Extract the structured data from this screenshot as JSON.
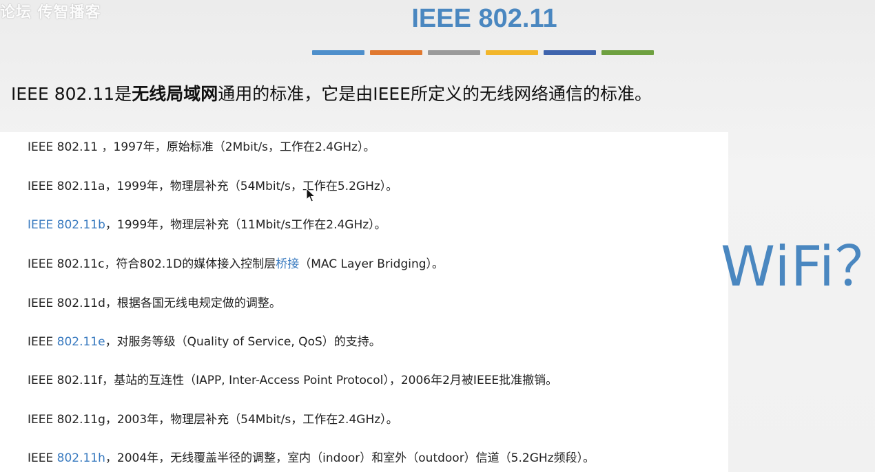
{
  "watermark": "论坛 传智播客",
  "title": "IEEE 802.11",
  "divider_colors": [
    "#4e8fcb",
    "#e0782f",
    "#9a9a9a",
    "#f2b62b",
    "#3f64ad",
    "#6ea040"
  ],
  "intro": {
    "prefix": "IEEE 802.11是",
    "bold": "无线局域网",
    "suffix": "通用的标准，它是由IEEE所定义的无线网络通信的标准。"
  },
  "items": [
    {
      "pre": "IEEE 802.11 ，1997年，原始标准（2Mbit/s，工作在2.4GHz）。",
      "link": "",
      "post": ""
    },
    {
      "pre": "IEEE 802.11a，1999年，物理层补充（54Mbit/s，工作在5.2GHz）。",
      "link": "",
      "post": ""
    },
    {
      "pre": "",
      "link": "IEEE 802.11b",
      "post": "，1999年，物理层补充（11Mbit/s工作在2.4GHz）。"
    },
    {
      "pre": "IEEE 802.11c，符合802.1D的媒体接入控制层",
      "link": "桥接",
      "post": "（MAC Layer Bridging）。"
    },
    {
      "pre": "IEEE 802.11d，根据各国无线电规定做的调整。",
      "link": "",
      "post": ""
    },
    {
      "pre": "IEEE ",
      "link": "802.11e",
      "post": "，对服务等级（Quality of Service, QoS）的支持。"
    },
    {
      "pre": "IEEE 802.11f，基站的互连性（IAPP, Inter-Access Point Protocol），2006年2月被IEEE批准撤销。",
      "link": "",
      "post": ""
    },
    {
      "pre": "IEEE 802.11g，2003年，物理层补充（54Mbit/s，工作在2.4GHz）。",
      "link": "",
      "post": ""
    },
    {
      "pre": "IEEE ",
      "link": "802.11h",
      "post": "，2004年，无线覆盖半径的调整，室内（indoor）和室外（outdoor）信道（5.2GHz频段）。"
    }
  ],
  "side_label": "WiFi？",
  "cursor_icon": "mouse-pointer-icon"
}
